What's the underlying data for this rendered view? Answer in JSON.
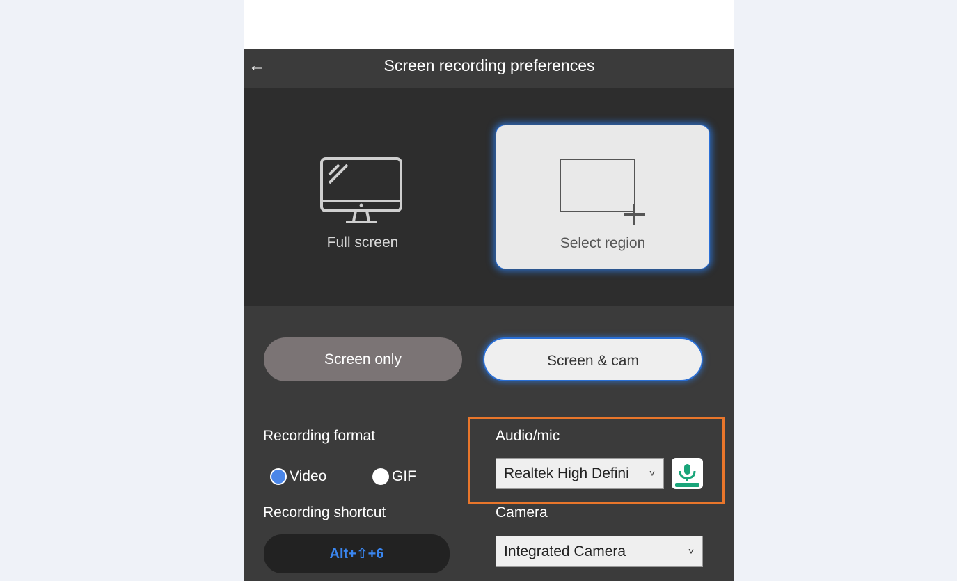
{
  "header": {
    "title": "Screen recording preferences",
    "back_icon": "←"
  },
  "modes": {
    "fullscreen_label": "Full screen",
    "region_label": "Select region"
  },
  "capture": {
    "screen_only": "Screen only",
    "screen_cam": "Screen & cam"
  },
  "format": {
    "label": "Recording format",
    "video": "Video",
    "gif": "GIF",
    "selected": "Video"
  },
  "shortcut": {
    "label": "Recording shortcut",
    "value": "Alt+⇧+6"
  },
  "audio": {
    "label": "Audio/mic",
    "selected": "Realtek High Defini",
    "caret": "˅"
  },
  "camera": {
    "label": "Camera",
    "selected": "Integrated Camera",
    "caret": "˅"
  },
  "colors": {
    "accent": "#2a6fd6",
    "highlight": "#e9762b",
    "mic_green": "#1aa57a",
    "shortcut_text": "#3a86f0"
  }
}
